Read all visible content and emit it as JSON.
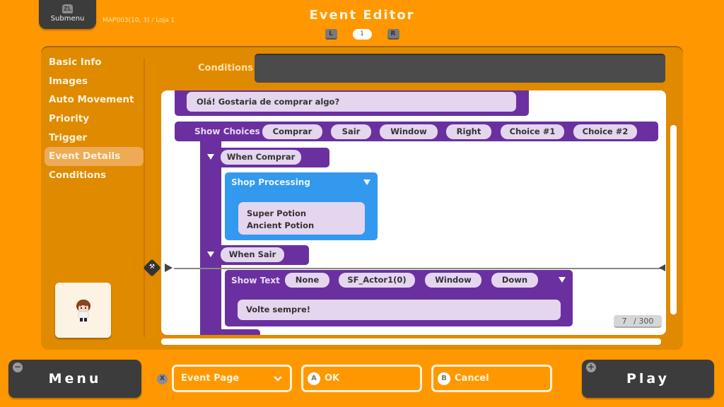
{
  "header": {
    "submenu_key": "ZL",
    "submenu_label": "Submenu",
    "map_info": "MAP003(10, 3) / Loja 1",
    "title": "Event Editor",
    "page_prev_key": "L",
    "page_number": "1",
    "page_next_key": "R"
  },
  "sidebar": {
    "items": [
      {
        "label": "Basic Info",
        "active": false
      },
      {
        "label": "Images",
        "active": false
      },
      {
        "label": "Auto Movement",
        "active": false
      },
      {
        "label": "Priority",
        "active": false
      },
      {
        "label": "Trigger",
        "active": false
      },
      {
        "label": "Event Details",
        "active": true
      },
      {
        "label": "Conditions",
        "active": false
      }
    ]
  },
  "conditions": {
    "label": "Conditions",
    "value": ""
  },
  "event_list": {
    "text_message": "Olá! Gostaria de comprar algo?",
    "show_choices": {
      "label": "Show Choices",
      "params": [
        "Comprar",
        "Sair",
        "Window",
        "Right",
        "Choice #1",
        "Choice #2"
      ]
    },
    "branch_1": {
      "label": "When Comprar",
      "shop": {
        "label": "Shop Processing",
        "items": [
          "Super Potion",
          "Ancient Potion"
        ]
      }
    },
    "branch_2": {
      "label": "When Sair",
      "show_text": {
        "label": "Show Text",
        "params": [
          "None",
          "SF_Actor1(0)",
          "Window",
          "Down"
        ],
        "message": "Volte sempre!"
      }
    },
    "counter": {
      "current": "7",
      "max": "/ 300"
    }
  },
  "colors": {
    "background": "#ff9800",
    "panel": "#e08a00",
    "command_block": "#6a30a0",
    "shop_block": "#3399ee",
    "pill": "#e4d6ef",
    "dark_button": "#3c3c3c"
  },
  "footer": {
    "menu_label": "Menu",
    "menu_key": "−",
    "page_key": "X",
    "event_page_label": "Event Page",
    "ok_key": "A",
    "ok_label": "OK",
    "cancel_key": "B",
    "cancel_label": "Cancel",
    "play_label": "Play",
    "play_key": "+"
  }
}
